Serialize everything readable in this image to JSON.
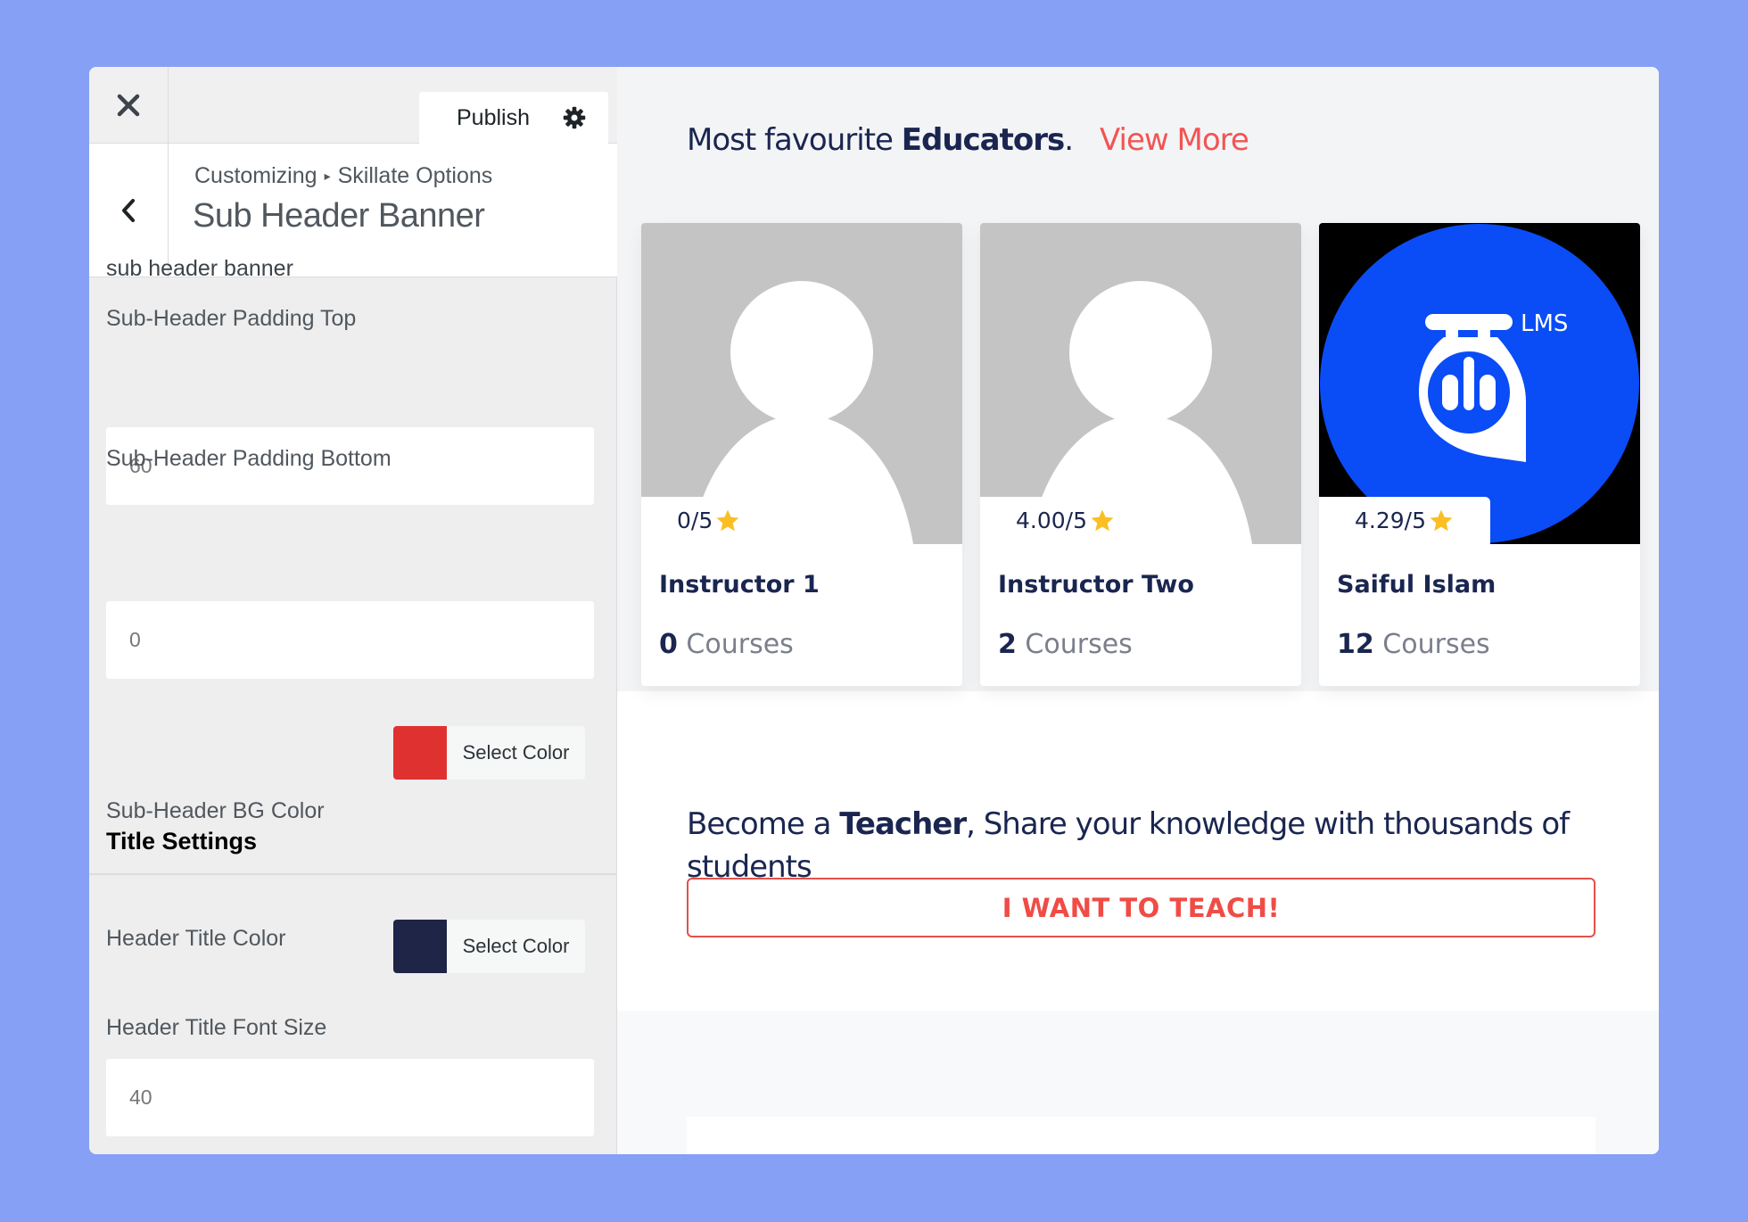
{
  "customizer": {
    "close_label": "Close",
    "publish_label": "Publish",
    "breadcrumb": {
      "root": "Customizing",
      "separator": "▸",
      "parent": "Skillate Options"
    },
    "section_title": "Sub Header Banner",
    "section_description": "sub header banner",
    "controls": {
      "padding_top": {
        "label": "Sub-Header Padding Top",
        "value": "60"
      },
      "padding_bottom": {
        "label": "Sub-Header Padding Bottom",
        "value": "0"
      },
      "bg_color": {
        "label": "Sub-Header BG Color",
        "button_label": "Select Color",
        "color": "#e03131"
      },
      "title_settings_heading": "Title Settings",
      "title_color": {
        "label": "Header Title Color",
        "button_label": "Select Color",
        "color": "#1f2547"
      },
      "title_font_size": {
        "label": "Header Title Font Size",
        "value": "40"
      }
    }
  },
  "preview": {
    "educators_heading": {
      "prefix": "Most favourite ",
      "bold": "Educators",
      "suffix": ".",
      "link": "View More"
    },
    "instructors": [
      {
        "name": "Instructor 1",
        "rating": "0/5",
        "course_count": "0",
        "courses_label": "Courses",
        "avatar": "placeholder"
      },
      {
        "name": "Instructor Two",
        "rating": "4.00/5",
        "course_count": "2",
        "courses_label": "Courses",
        "avatar": "placeholder"
      },
      {
        "name": "Saiful Islam",
        "rating": "4.29/5",
        "course_count": "12",
        "courses_label": "Courses",
        "avatar": "lms-logo",
        "logo_text": "LMS"
      }
    ],
    "teacher_cta": {
      "prefix": "Become a ",
      "bold": "Teacher",
      "suffix": ", Share your knowledge with thousands of students",
      "button": "I WANT TO TEACH!"
    }
  },
  "colors": {
    "accent_red": "#f25454",
    "navy": "#1a2650",
    "star": "#fbbf24",
    "logo_blue": "#0a4cf5",
    "backdrop": "#86a0f5"
  }
}
